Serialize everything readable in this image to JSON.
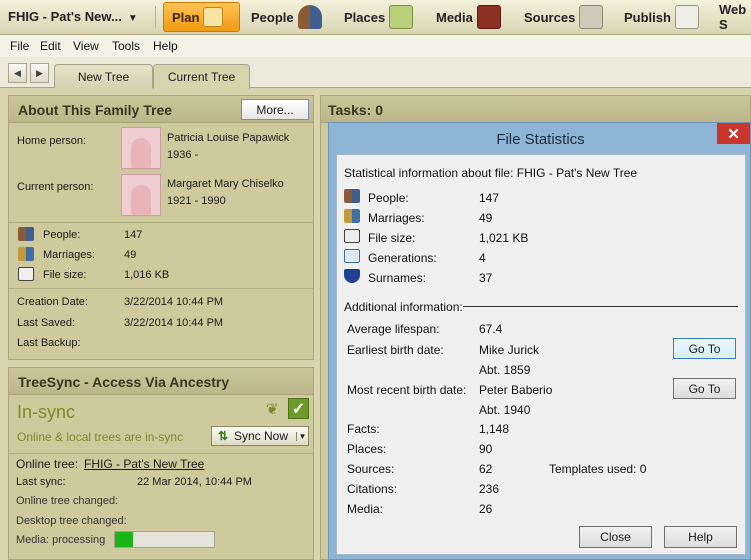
{
  "toolbar": {
    "file_name": "FHIG - Pat's New...",
    "dropdown_arrow": "▼",
    "buttons": [
      "Plan",
      "People",
      "Places",
      "Media",
      "Sources",
      "Publish",
      "Web S"
    ]
  },
  "menu": [
    "File",
    "Edit",
    "View",
    "Tools",
    "Help"
  ],
  "tabs": [
    "New Tree",
    "Current Tree"
  ],
  "about": {
    "title": "About This Family Tree",
    "more_label": "More...",
    "home_label": "Home person:",
    "home_name": "Patricia Louise Papawick",
    "home_years": "1936 -",
    "current_label": "Current person:",
    "current_name": "Margaret Mary Chiselko",
    "current_years": "1921 - 1990",
    "stats": [
      {
        "label": "People:",
        "value": "147"
      },
      {
        "label": "Marriages:",
        "value": "49"
      },
      {
        "label": "File size:",
        "value": "1,016 KB"
      }
    ],
    "dates": [
      {
        "label": "Creation Date:",
        "value": "3/22/2014 10:44 PM"
      },
      {
        "label": "Last Saved:",
        "value": "3/22/2014 10:44 PM"
      },
      {
        "label": "Last Backup:",
        "value": ""
      }
    ]
  },
  "treesync": {
    "title": "TreeSync - Access Via Ancestry",
    "status": "In-sync",
    "status_sub": "Online & local trees are in-sync",
    "sync_label": "Sync Now",
    "online_tree_label": "Online tree:",
    "online_tree_link": "FHIG - Pat's New Tree",
    "last_sync_label": "Last sync:",
    "last_sync_value": "22 Mar 2014, 10:44 PM",
    "online_changed_label": "Online tree changed:",
    "desktop_changed_label": "Desktop tree changed:",
    "media_label": "Media: processing",
    "media_progress": 0.18
  },
  "tasks": {
    "title": "Tasks: 0"
  },
  "dialog": {
    "title": "File Statistics",
    "close_glyph": "✕",
    "intro": "Statistical information about file: FHIG - Pat's New Tree",
    "stats": [
      {
        "label": "People:",
        "value": "147"
      },
      {
        "label": "Marriages:",
        "value": "49"
      },
      {
        "label": "File size:",
        "value": "1,021 KB"
      },
      {
        "label": "Generations:",
        "value": "4"
      },
      {
        "label": "Surnames:",
        "value": "37"
      }
    ],
    "additional_heading": "Additional information:",
    "avg_label": "Average lifespan:",
    "avg_value": "67.4",
    "earliest_label": "Earliest birth date:",
    "earliest_name": "Mike Jurick",
    "earliest_date": "Abt. 1859",
    "recent_label": "Most recent birth date:",
    "recent_name": "Peter Baberio",
    "recent_date": "Abt. 1940",
    "goto_label": "Go To",
    "facts_label": "Facts:",
    "facts_value": "1,148",
    "places_label": "Places:",
    "places_value": "90",
    "sources_label": "Sources:",
    "sources_value": "62",
    "templates_label": "Templates used: 0",
    "citations_label": "Citations:",
    "citations_value": "236",
    "media_label": "Media:",
    "media_value": "26",
    "close_label": "Close",
    "help_label": "Help"
  }
}
